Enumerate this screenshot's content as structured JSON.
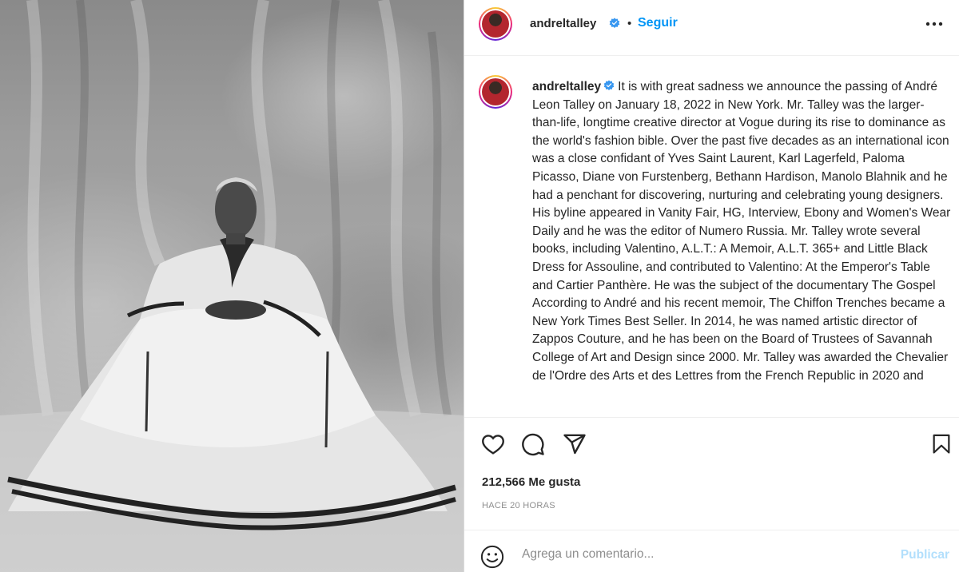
{
  "post": {
    "username": "andreltalley",
    "verified": true,
    "dot": "•",
    "follow_label": "Seguir",
    "caption": "It is with great sadness we announce the passing of André Leon Talley on January 18, 2022 in New York. Mr. Talley was the larger-than-life, longtime creative director at Vogue during its rise to dominance as the world's fashion bible. Over the past five decades as an international icon was a close confidant of Yves Saint Laurent, Karl Lagerfeld, Paloma Picasso, Diane von Furstenberg, Bethann Hardison, Manolo Blahnik and he had a penchant for discovering, nurturing and celebrating young designers. His byline appeared in Vanity Fair, HG, Interview, Ebony and Women's Wear Daily and he was the editor of Numero Russia. Mr. Talley wrote several books, including Valentino, A.L.T.: A Memoir, A.L.T. 365+ and Little Black Dress for Assouline, and contributed to Valentino: At the Emperor's Table and Cartier Panthère. He was the subject of the documentary The Gospel According to André and his recent memoir, The Chiffon Trenches became a New York Times Best Seller. In 2014, he was named artistic director of Zappos Couture, and he has been on the Board of Trustees of Savannah College of Art and Design since 2000. Mr. Talley was awarded the Chevalier de l'Ordre des Arts et des Lettres from the French Republic in 2020 and",
    "likes_text": "212,566 Me gusta",
    "time_text": "HACE 20 HORAS"
  },
  "comment": {
    "placeholder": "Agrega un comentario...",
    "publish_label": "Publicar"
  },
  "colors": {
    "accent": "#0095f6",
    "verified": "#3897f0",
    "publish_disabled": "#b2dffc"
  },
  "icons": [
    "more-options-icon",
    "heart-icon",
    "comment-icon",
    "share-icon",
    "bookmark-icon",
    "emoji-icon",
    "verified-badge-icon"
  ]
}
